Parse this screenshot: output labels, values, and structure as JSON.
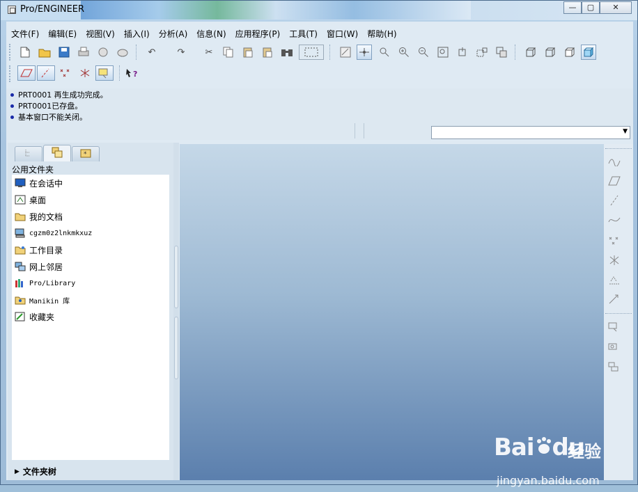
{
  "window": {
    "title": "Pro/ENGINEER",
    "minimize": "—",
    "maximize": "▢",
    "close": "✕"
  },
  "menu": [
    "文件(F)",
    "编辑(E)",
    "视图(V)",
    "插入(I)",
    "分析(A)",
    "信息(N)",
    "应用程序(P)",
    "工具(T)",
    "窗口(W)",
    "帮助(H)"
  ],
  "toolbar_icons": [
    "new-icon",
    "open-icon",
    "save-icon",
    "print-icon",
    "send-icon",
    "send-mail-icon",
    "undo-icon",
    "redo-icon",
    "cut-icon",
    "copy-icon",
    "paste-icon",
    "paste-special-icon",
    "find-icon",
    "select-box-icon",
    "repaint-icon",
    "spin-center-icon",
    "orient-icon",
    "zoom-in-icon",
    "zoom-out-icon",
    "refit-icon",
    "reorient-icon",
    "saved-views-icon",
    "layers-icon",
    "wireframe-icon",
    "hidden-line-icon",
    "no-hidden-icon",
    "shading-icon"
  ],
  "messages": [
    "PRT0001 再生成功完成。",
    "PRT0001已存盘。",
    "基本窗口不能关闭。"
  ],
  "command_input": {
    "value": ""
  },
  "navigator": {
    "header": "公用文件夹",
    "items": [
      {
        "label": "在会话中",
        "icon": "session-icon"
      },
      {
        "label": "桌面",
        "icon": "desktop-icon"
      },
      {
        "label": "我的文档",
        "icon": "my-documents-icon"
      },
      {
        "label": "cgzm0z2lnkmkxuz",
        "icon": "computer-icon"
      },
      {
        "label": "工作目录",
        "icon": "working-directory-icon"
      },
      {
        "label": "网上邻居",
        "icon": "network-icon"
      },
      {
        "label": "Pro/Library",
        "icon": "library-icon"
      },
      {
        "label": "Manikin 库",
        "icon": "manikin-library-icon"
      },
      {
        "label": "收藏夹",
        "icon": "favorites-icon"
      }
    ],
    "footer": "文件夹树"
  },
  "watermark": {
    "brand": "Bai",
    "suffix": "du",
    "cn": "经验",
    "url": "jingyan.baidu.com"
  }
}
